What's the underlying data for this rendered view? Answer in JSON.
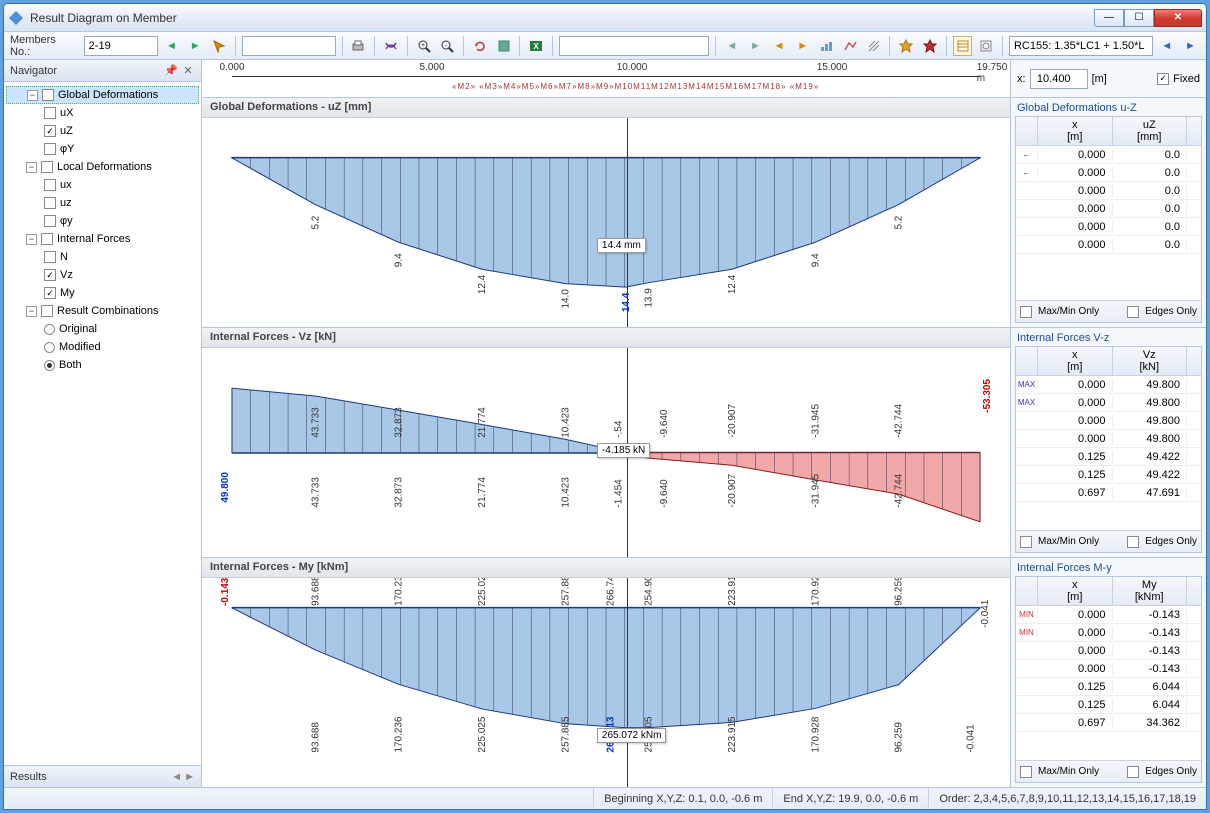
{
  "window": {
    "title": "Result Diagram on Member"
  },
  "toolbar": {
    "members_label": "Members No.:",
    "members_value": "2-19",
    "combo_value": "RC155: 1.35*LC1 + 1.50*L"
  },
  "navigator": {
    "title": "Navigator",
    "groups": [
      {
        "label": "Global Deformations",
        "selected": true,
        "children": [
          {
            "label": "uX",
            "checked": false
          },
          {
            "label": "uZ",
            "checked": true
          },
          {
            "label": "φY",
            "checked": false
          }
        ]
      },
      {
        "label": "Local Deformations",
        "children": [
          {
            "label": "ux",
            "checked": false
          },
          {
            "label": "uz",
            "checked": false
          },
          {
            "label": "φy",
            "checked": false
          }
        ]
      },
      {
        "label": "Internal Forces",
        "children": [
          {
            "label": "N",
            "checked": false
          },
          {
            "label": "Vz",
            "checked": true
          },
          {
            "label": "My",
            "checked": true
          }
        ]
      },
      {
        "label": "Result Combinations",
        "type": "radio",
        "children": [
          {
            "label": "Original",
            "on": false
          },
          {
            "label": "Modified",
            "on": false
          },
          {
            "label": "Both",
            "on": true
          }
        ]
      }
    ],
    "footer_tab": "Results"
  },
  "ruler": {
    "ticks": [
      "0.000",
      "5.000",
      "10.000",
      "15.000",
      "19.750 m"
    ],
    "x_label": "x:",
    "x_value": "10.400",
    "x_unit": "[m]",
    "fixed_label": "Fixed",
    "fixed_checked": true
  },
  "charts": [
    {
      "title": "Global Deformations - uZ [mm]",
      "tooltip": "14.4 mm",
      "labels": [
        "5.2",
        "9.4",
        "12.4",
        "14.0",
        "14.4",
        "13.9",
        "12.4",
        "9.4",
        "5.2"
      ]
    },
    {
      "title": "Internal Forces - Vz [kN]",
      "tooltip": "-4.185 kN",
      "left": "49.800",
      "right": "-53.305",
      "top": [
        "43.733",
        "32.873",
        "21.774",
        "10.423",
        "-.54",
        "-9.640",
        "-20.907",
        "-31.945",
        "-42.744"
      ],
      "bot": [
        "43.733",
        "32.873",
        "21.774",
        "10.423",
        "-1.454",
        "-9.640",
        "-20.907",
        "-31.945",
        "-42.744"
      ]
    },
    {
      "title": "Internal Forces - My [kNm]",
      "tooltip": "265.072 kNm",
      "left": "-0.143",
      "right": "-0.041",
      "top": [
        "93.688",
        "170.236",
        "225.025",
        "257.885",
        "266.741",
        "254.905",
        "223.915",
        "170.928",
        "96.259"
      ],
      "bot": [
        "93.688",
        "170.236",
        "225.025",
        "257.885",
        "266.913",
        "254.905",
        "223.915",
        "170.928",
        "96.259",
        "-0.041"
      ]
    }
  ],
  "tables": [
    {
      "title": "Global Deformations u-Z",
      "h1": "x\n[m]",
      "h2": "uZ\n[mm]",
      "rows": [
        {
          "ic": "←",
          "x": "0.000",
          "v": "0.0"
        },
        {
          "ic": "←",
          "x": "0.000",
          "v": "0.0"
        },
        {
          "ic": "",
          "x": "0.000",
          "v": "0.0"
        },
        {
          "ic": "",
          "x": "0.000",
          "v": "0.0"
        },
        {
          "ic": "",
          "x": "0.000",
          "v": "0.0"
        },
        {
          "ic": "",
          "x": "0.000",
          "v": "0.0"
        }
      ],
      "maxmin": "Max/Min Only",
      "edges": "Edges Only"
    },
    {
      "title": "Internal Forces V-z",
      "h1": "x\n[m]",
      "h2": "Vz\n[kN]",
      "rows": [
        {
          "ic": "MAX",
          "x": "0.000",
          "v": "49.800"
        },
        {
          "ic": "MAX",
          "x": "0.000",
          "v": "49.800"
        },
        {
          "ic": "",
          "x": "0.000",
          "v": "49.800"
        },
        {
          "ic": "",
          "x": "0.000",
          "v": "49.800"
        },
        {
          "ic": "",
          "x": "0.125",
          "v": "49.422"
        },
        {
          "ic": "",
          "x": "0.125",
          "v": "49.422"
        },
        {
          "ic": "",
          "x": "0.697",
          "v": "47.691"
        }
      ],
      "maxmin": "Max/Min Only",
      "edges": "Edges Only"
    },
    {
      "title": "Internal Forces M-y",
      "h1": "x\n[m]",
      "h2": "My\n[kNm]",
      "rows": [
        {
          "ic": "MIN",
          "x": "0.000",
          "v": "-0.143"
        },
        {
          "ic": "MIN",
          "x": "0.000",
          "v": "-0.143"
        },
        {
          "ic": "",
          "x": "0.000",
          "v": "-0.143"
        },
        {
          "ic": "",
          "x": "0.000",
          "v": "-0.143"
        },
        {
          "ic": "",
          "x": "0.125",
          "v": "6.044"
        },
        {
          "ic": "",
          "x": "0.125",
          "v": "6.044"
        },
        {
          "ic": "",
          "x": "0.697",
          "v": "34.362"
        }
      ],
      "maxmin": "Max/Min Only",
      "edges": "Edges Only"
    }
  ],
  "status": {
    "beginning": "Beginning X,Y,Z:   0.1, 0.0, -0.6 m",
    "end": "End X,Y,Z:   19.9, 0.0, -0.6 m",
    "order": "Order:   2,3,4,5,6,7,8,9,10,11,12,13,14,15,16,17,18,19"
  },
  "chart_data": [
    {
      "type": "area",
      "title": "Global Deformations - uZ [mm]",
      "x": [
        0,
        2.2,
        4.4,
        6.6,
        8.8,
        10.4,
        11.0,
        13.2,
        15.4,
        17.6,
        19.75
      ],
      "values": [
        0,
        5.2,
        9.4,
        12.4,
        14.0,
        14.4,
        13.9,
        12.4,
        9.4,
        5.2,
        0
      ],
      "xlabel": "x [m]",
      "ylabel": "uZ [mm]",
      "ylim": [
        0,
        15
      ]
    },
    {
      "type": "area",
      "title": "Internal Forces - Vz [kN]",
      "x": [
        0,
        2.2,
        4.4,
        6.6,
        8.8,
        10.4,
        11.0,
        13.2,
        15.4,
        17.6,
        19.75
      ],
      "values": [
        49.8,
        43.733,
        32.873,
        21.774,
        10.423,
        -1.454,
        -4.185,
        -9.64,
        -20.907,
        -31.945,
        -53.305
      ],
      "xlabel": "x [m]",
      "ylabel": "Vz [kN]",
      "ylim": [
        -55,
        55
      ]
    },
    {
      "type": "area",
      "title": "Internal Forces - My [kNm]",
      "x": [
        0,
        2.2,
        4.4,
        6.6,
        8.8,
        10.4,
        11.0,
        13.2,
        15.4,
        17.6,
        19.75
      ],
      "values": [
        -0.143,
        93.688,
        170.236,
        225.025,
        257.885,
        266.913,
        266.741,
        254.905,
        223.915,
        170.928,
        -0.041
      ],
      "xlabel": "x [m]",
      "ylabel": "My [kNm]",
      "ylim": [
        -1,
        270
      ]
    }
  ]
}
